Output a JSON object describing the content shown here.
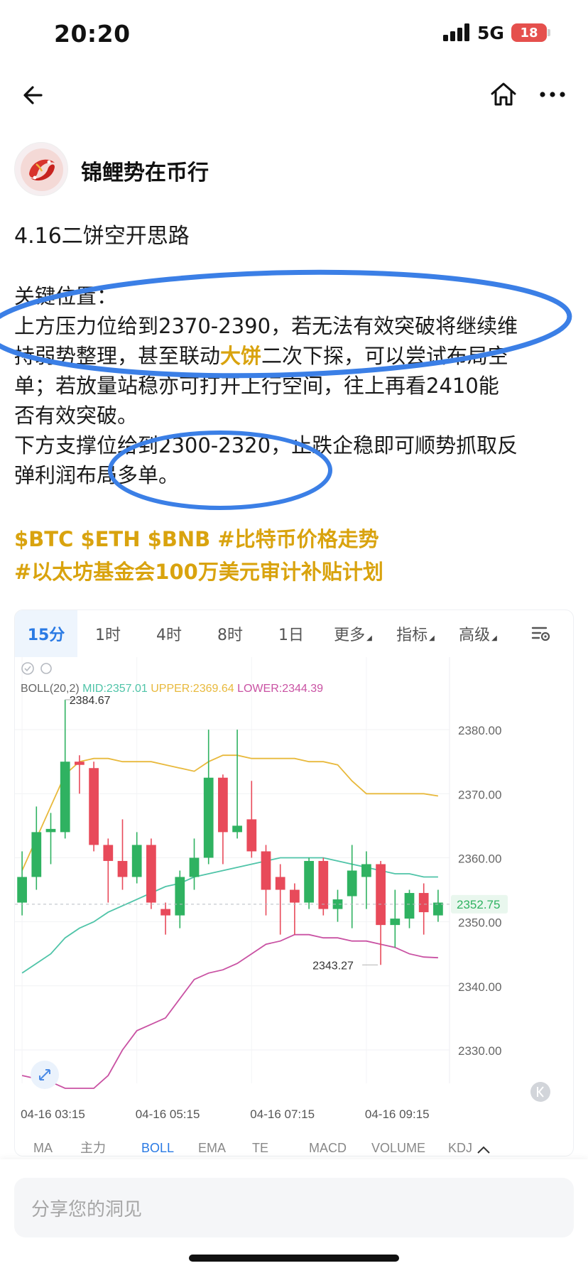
{
  "status_bar": {
    "time": "20:20",
    "network": "5G",
    "battery": "18"
  },
  "nav": {
    "back_icon": "arrow-left-icon",
    "home_icon": "home-icon",
    "more_icon": "more-dots-icon"
  },
  "author": {
    "name": "锦鲤势在币行",
    "avatar_icon": "koi-avatar"
  },
  "post": {
    "title": "4.16二饼空开思路",
    "lines": [
      "关键位置：",
      "上方压力位给到2370-2390，若无法有效突破将继续维",
      "持弱势整理，甚至联动",
      "大饼",
      "二次下探，可以尝试布局空",
      "单；若放量站稳亦可打开上行空间，往上再看2410能",
      "否有效突破。",
      "下方支撑位给到2300-2320，止跌企稳即可顺势抓取反",
      "弹利润布局多单。"
    ],
    "tags_line1": "$BTC $ETH $BNB #比特币价格走势",
    "tags_line2": "#以太坊基金会100万美元审计补贴计划",
    "highlight_color": "#d9a30e",
    "annotation_color": "#3b7fe6"
  },
  "chart_toolbar": {
    "tabs": [
      {
        "label": "15分",
        "active": true
      },
      {
        "label": "1时",
        "active": false
      },
      {
        "label": "4时",
        "active": false
      },
      {
        "label": "8时",
        "active": false
      },
      {
        "label": "1日",
        "active": false
      },
      {
        "label": "更多",
        "active": false,
        "caret": true
      },
      {
        "label": "指标",
        "active": false,
        "caret": true
      },
      {
        "label": "高级",
        "active": false,
        "caret": true
      }
    ],
    "settings_icon": "chart-settings-icon"
  },
  "chart_data": {
    "type": "candlestick",
    "indicator": "BOLL(20,2)",
    "legend": {
      "boll": "BOLL(20,2)",
      "mid": "MID:2357.01",
      "upper": "UPPER:2369.64",
      "lower": "LOWER:2344.39"
    },
    "colors": {
      "up": "#2fb261",
      "down": "#e84a5a",
      "mid": "#4fc4a8",
      "upper": "#e8b93c",
      "lower": "#c952a3",
      "price_tag": "#2fb261"
    },
    "y_range": [
      2327,
      2388
    ],
    "y_ticks": [
      "2380.00",
      "2370.00",
      "2360.00",
      "2350.00",
      "2340.00",
      "2330.00"
    ],
    "y_tick_values": [
      2380,
      2370,
      2360,
      2350,
      2340,
      2330
    ],
    "x_ticks": [
      "04-16 03:15",
      "04-16 05:15",
      "04-16 07:15",
      "04-16 09:15"
    ],
    "x_tick_index": [
      0,
      8,
      16,
      24
    ],
    "last_price": "2352.75",
    "last_price_value": 2352.75,
    "high_label": "2384.67",
    "high_value": 2384.67,
    "high_index": 3,
    "low_label": "2343.27",
    "low_value": 2343.27,
    "low_index": 25,
    "candles": [
      {
        "o": 2353,
        "c": 2357,
        "h": 2361,
        "l": 2351
      },
      {
        "o": 2357,
        "c": 2364,
        "h": 2368,
        "l": 2355
      },
      {
        "o": 2364,
        "c": 2364.5,
        "h": 2367,
        "l": 2359
      },
      {
        "o": 2364,
        "c": 2375,
        "h": 2384.67,
        "l": 2363
      },
      {
        "o": 2375,
        "c": 2374.5,
        "h": 2376,
        "l": 2370
      },
      {
        "o": 2374,
        "c": 2362,
        "h": 2375,
        "l": 2361
      },
      {
        "o": 2362,
        "c": 2359.5,
        "h": 2363,
        "l": 2353
      },
      {
        "o": 2359.5,
        "c": 2357,
        "h": 2366,
        "l": 2355
      },
      {
        "o": 2357,
        "c": 2362,
        "h": 2364,
        "l": 2356
      },
      {
        "o": 2362,
        "c": 2353,
        "h": 2363,
        "l": 2352
      },
      {
        "o": 2352,
        "c": 2351,
        "h": 2353,
        "l": 2348
      },
      {
        "o": 2351,
        "c": 2357,
        "h": 2358,
        "l": 2349
      },
      {
        "o": 2357,
        "c": 2360,
        "h": 2363,
        "l": 2355
      },
      {
        "o": 2360,
        "c": 2372.5,
        "h": 2380,
        "l": 2359
      },
      {
        "o": 2372.5,
        "c": 2364,
        "h": 2373,
        "l": 2359
      },
      {
        "o": 2364,
        "c": 2365,
        "h": 2380,
        "l": 2363
      },
      {
        "o": 2366,
        "c": 2361,
        "h": 2372,
        "l": 2360
      },
      {
        "o": 2361,
        "c": 2355,
        "h": 2362,
        "l": 2351
      },
      {
        "o": 2357,
        "c": 2355,
        "h": 2359,
        "l": 2348
      },
      {
        "o": 2355,
        "c": 2353,
        "h": 2356,
        "l": 2348
      },
      {
        "o": 2353,
        "c": 2359.5,
        "h": 2360,
        "l": 2352
      },
      {
        "o": 2359.5,
        "c": 2352,
        "h": 2360,
        "l": 2351
      },
      {
        "o": 2352,
        "c": 2353.5,
        "h": 2355,
        "l": 2350
      },
      {
        "o": 2354,
        "c": 2358,
        "h": 2362,
        "l": 2349
      },
      {
        "o": 2357,
        "c": 2359,
        "h": 2361,
        "l": 2352
      },
      {
        "o": 2359,
        "c": 2349.5,
        "h": 2359.5,
        "l": 2343.27
      },
      {
        "o": 2349.5,
        "c": 2350.5,
        "h": 2355,
        "l": 2346
      },
      {
        "o": 2350.5,
        "c": 2354.5,
        "h": 2355,
        "l": 2349
      },
      {
        "o": 2354.5,
        "c": 2351.5,
        "h": 2356,
        "l": 2348
      },
      {
        "o": 2351,
        "c": 2353,
        "h": 2355,
        "l": 2350
      }
    ],
    "mid_line": [
      2342,
      2343.5,
      2345,
      2347.5,
      2349,
      2350,
      2351.5,
      2352.5,
      2353.5,
      2354.5,
      2355.5,
      2356,
      2357,
      2357.5,
      2358,
      2358.5,
      2359,
      2359.5,
      2360,
      2360,
      2360,
      2360,
      2359.5,
      2359,
      2358.5,
      2358,
      2357.5,
      2357.5,
      2357,
      2357
    ],
    "upper_line": [
      2358,
      2363,
      2368,
      2373,
      2375,
      2375.5,
      2375.5,
      2375,
      2375,
      2375,
      2374.5,
      2374,
      2373.5,
      2375,
      2376,
      2376,
      2375.5,
      2375.5,
      2375.5,
      2375.5,
      2375,
      2375,
      2374.5,
      2372,
      2370,
      2370,
      2370,
      2370,
      2370,
      2369.64
    ],
    "lower_line": [
      2326,
      2325.5,
      2325,
      2324,
      2324,
      2324,
      2326,
      2330,
      2333,
      2334,
      2335,
      2338,
      2341,
      2342,
      2342.5,
      2343.5,
      2345,
      2346.5,
      2347,
      2348,
      2348,
      2347.5,
      2347.5,
      2347,
      2347,
      2346.5,
      2346,
      2345,
      2344.5,
      2344.39
    ]
  },
  "indicator_tabs": [
    "MA",
    "主力",
    "BOLL",
    "EMA",
    "TE",
    "MACD",
    "VOLUME",
    "KDJ"
  ],
  "comment": {
    "placeholder": "分享您的洞见"
  }
}
